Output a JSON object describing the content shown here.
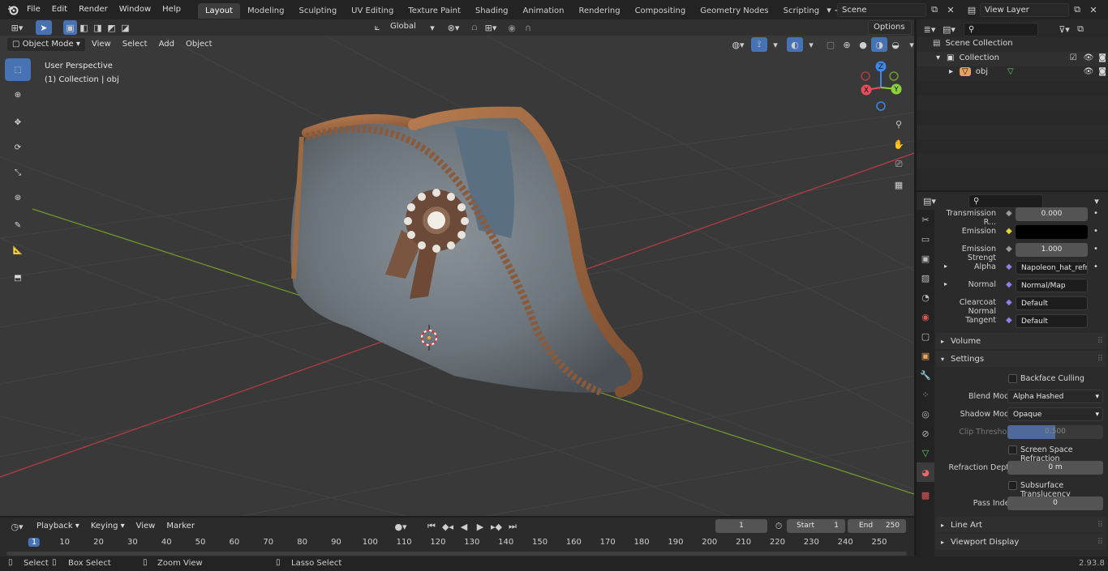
{
  "menu": {
    "file": "File",
    "edit": "Edit",
    "render": "Render",
    "window": "Window",
    "help": "Help"
  },
  "workspaces": [
    "Layout",
    "Modeling",
    "Sculpting",
    "UV Editing",
    "Texture Paint",
    "Shading",
    "Animation",
    "Rendering",
    "Compositing",
    "Geometry Nodes",
    "Scripting"
  ],
  "scene_name": "Scene",
  "view_layer": "View Layer",
  "header": {
    "orientation": "Global",
    "options": "Options",
    "mode": "Object Mode",
    "view": "View",
    "select": "Select",
    "add": "Add",
    "object": "Object"
  },
  "viewport": {
    "title": "User Perspective",
    "subtitle": "(1) Collection | obj"
  },
  "gizmo": {
    "z": "Z",
    "x": "X",
    "y": "Y"
  },
  "outliner": {
    "scene_collection": "Scene Collection",
    "collection": "Collection",
    "object": "obj"
  },
  "props": {
    "transmission_label": "Transmission R...",
    "transmission_value": "0.000",
    "emission_label": "Emission",
    "emission_strength_label": "Emission Strengt",
    "emission_strength_value": "1.000",
    "alpha_label": "Alpha",
    "alpha_value": "Napoleon_hat_refra...",
    "normal_label": "Normal",
    "normal_value": "Normal/Map",
    "clearcoat_label": "Clearcoat Normal",
    "clearcoat_value": "Default",
    "tangent_label": "Tangent",
    "tangent_value": "Default",
    "volume": "Volume",
    "settings": "Settings",
    "backface": "Backface Culling",
    "blend_label": "Blend Mode",
    "blend_value": "Alpha Hashed",
    "shadow_label": "Shadow Mode",
    "shadow_value": "Opaque",
    "clip_label": "Clip Threshold",
    "clip_value": "0.500",
    "clip_fraction": 0.5,
    "ssr": "Screen Space Refraction",
    "refraction_label": "Refraction Depth",
    "refraction_value": "0 m",
    "subsurface": "Subsurface Translucency",
    "pass_label": "Pass Index",
    "pass_value": "0",
    "lineart": "Line Art",
    "viewport_display": "Viewport Display"
  },
  "timeline": {
    "playback": "Playback",
    "keying": "Keying",
    "view": "View",
    "marker": "Marker",
    "current_frame": "1",
    "start_label": "Start",
    "start_value": "1",
    "end_label": "End",
    "end_value": "250",
    "ticks": [
      "1",
      "10",
      "20",
      "30",
      "40",
      "50",
      "60",
      "70",
      "80",
      "90",
      "100",
      "110",
      "120",
      "130",
      "140",
      "150",
      "160",
      "170",
      "180",
      "190",
      "200",
      "210",
      "220",
      "230",
      "240",
      "250"
    ]
  },
  "status": {
    "select": "Select",
    "box_select": "Box Select",
    "zoom_view": "Zoom View",
    "lasso_select": "Lasso Select",
    "version": "2.93.8"
  },
  "colors": {
    "accent": "#4772b3",
    "emission": "#000000",
    "x_axis": "#e74d5c",
    "y_axis": "#8bd13c",
    "z_axis": "#3d87e6"
  }
}
